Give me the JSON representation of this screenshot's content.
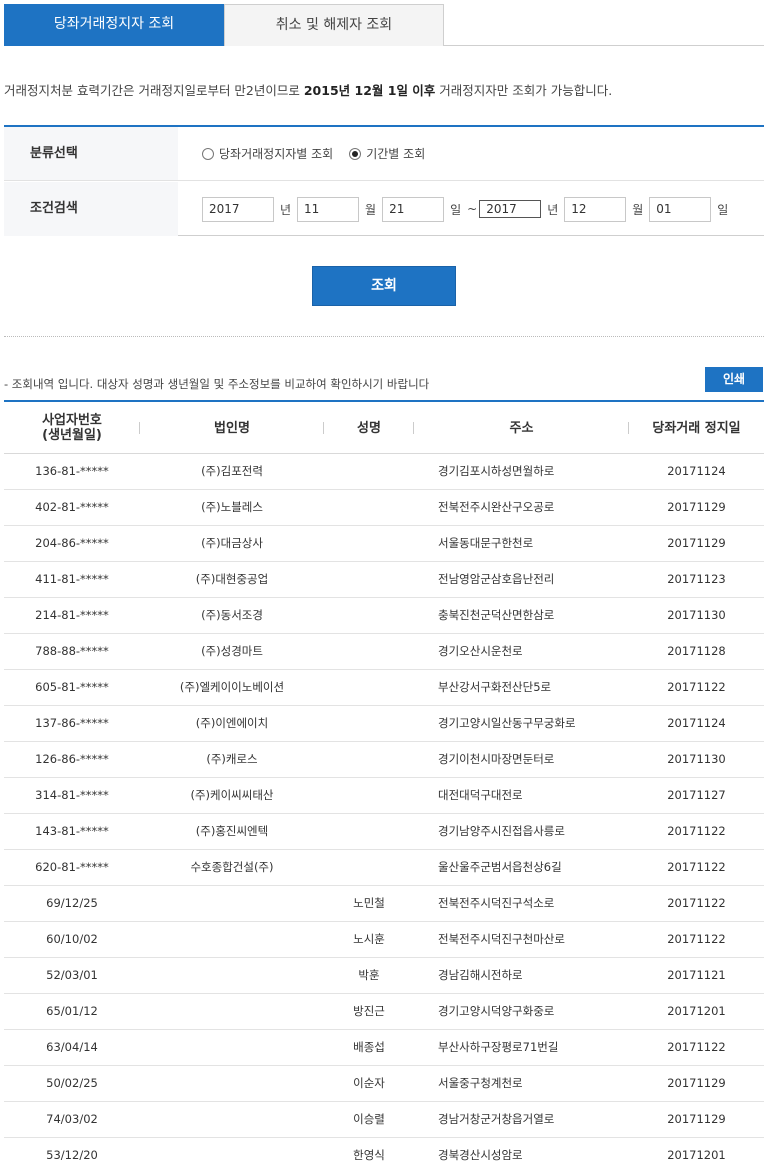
{
  "tabs": [
    {
      "label": "당좌거래정지자 조회"
    },
    {
      "label": "취소 및 해제자 조회"
    }
  ],
  "notice": {
    "prefix": "거래정지처분 효력기간은 거래정지일로부터 만2년이므로 ",
    "highlight": "2015년 12월 1일 이후",
    "suffix": " 거래정지자만 조회가 가능합니다."
  },
  "form": {
    "category_label": "분류선택",
    "radio_options": [
      "당좌거래정지자별 조회",
      "기간별 조회"
    ],
    "radio_selected_index": 1,
    "condition_label": "조건검색",
    "start": {
      "year": "2017",
      "month": "11",
      "day": "21"
    },
    "end": {
      "year": "2017",
      "month": "12",
      "day": "01"
    },
    "unit_year": "년",
    "unit_month": "월",
    "unit_day": "일",
    "tilde": "~"
  },
  "search_button": "조회",
  "result_note": "- 조회내역 입니다. 대상자 성명과 생년월일 및 주소정보를 비교하여 확인하시기 바랍니다",
  "print_button": "인쇄",
  "table": {
    "headers": [
      "사업자번호\n(생년월일)",
      "법인명",
      "성명",
      "주소",
      "당좌거래 정지일"
    ],
    "rows": [
      [
        "136-81-*****",
        "(주)김포전력",
        "",
        "경기김포시하성면월하로",
        "20171124"
      ],
      [
        "402-81-*****",
        "(주)노블레스",
        "",
        "전북전주시완산구오공로",
        "20171129"
      ],
      [
        "204-86-*****",
        "(주)대금상사",
        "",
        "서울동대문구한천로",
        "20171129"
      ],
      [
        "411-81-*****",
        "(주)대현중공업",
        "",
        "전남영암군삼호읍난전리",
        "20171123"
      ],
      [
        "214-81-*****",
        "(주)동서조경",
        "",
        "충북진천군덕산면한삼로",
        "20171130"
      ],
      [
        "788-88-*****",
        "(주)성경마트",
        "",
        "경기오산시운천로",
        "20171128"
      ],
      [
        "605-81-*****",
        "(주)엘케이이노베이션",
        "",
        "부산강서구화전산단5로",
        "20171122"
      ],
      [
        "137-86-*****",
        "(주)이엔에이치",
        "",
        "경기고양시일산동구무궁화로",
        "20171124"
      ],
      [
        "126-86-*****",
        "(주)캐로스",
        "",
        "경기이천시마장면둔터로",
        "20171130"
      ],
      [
        "314-81-*****",
        "(주)케이씨씨태산",
        "",
        "대전대덕구대전로",
        "20171127"
      ],
      [
        "143-81-*****",
        "(주)홍진씨엔텍",
        "",
        "경기남양주시진접읍사릉로",
        "20171122"
      ],
      [
        "620-81-*****",
        "수호종합건설(주)",
        "",
        "울산울주군범서읍천상6길",
        "20171122"
      ],
      [
        "69/12/25",
        "",
        "노민철",
        "전북전주시덕진구석소로",
        "20171122"
      ],
      [
        "60/10/02",
        "",
        "노시훈",
        "전북전주시덕진구천마산로",
        "20171122"
      ],
      [
        "52/03/01",
        "",
        "박훈",
        "경남김해시전하로",
        "20171121"
      ],
      [
        "65/01/12",
        "",
        "방진근",
        "경기고양시덕양구화중로",
        "20171201"
      ],
      [
        "63/04/14",
        "",
        "배종섭",
        "부산사하구장평로71번길",
        "20171122"
      ],
      [
        "50/02/25",
        "",
        "이순자",
        "서울중구청계천로",
        "20171129"
      ],
      [
        "74/03/02",
        "",
        "이승렬",
        "경남거창군거창읍거열로",
        "20171129"
      ],
      [
        "53/12/20",
        "",
        "한영식",
        "경북경산시성암로",
        "20171201"
      ]
    ]
  },
  "colors": {
    "accent": "#1e73c3"
  }
}
